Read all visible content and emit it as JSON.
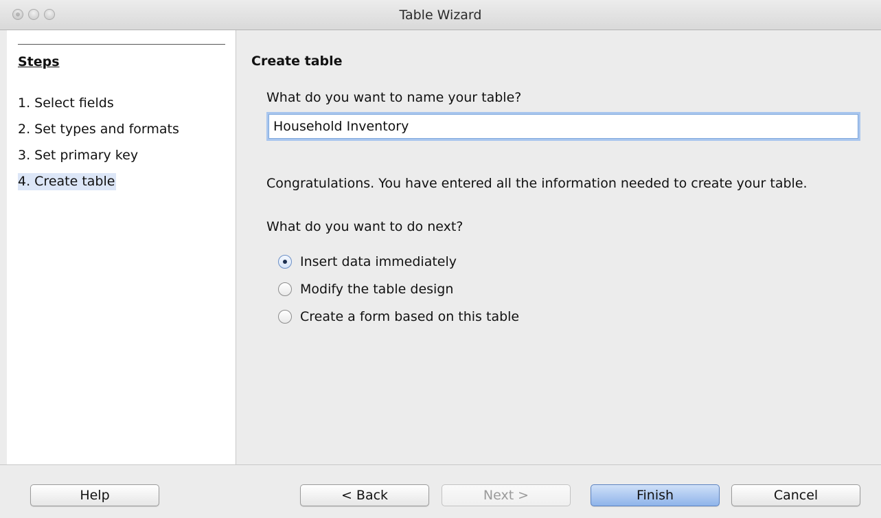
{
  "window": {
    "title": "Table Wizard"
  },
  "steps": {
    "heading": "Steps",
    "items": [
      {
        "label": "1. Select fields"
      },
      {
        "label": "2. Set types and formats"
      },
      {
        "label": "3. Set primary key"
      },
      {
        "label": "4. Create table",
        "active": true
      }
    ]
  },
  "main": {
    "heading": "Create table",
    "name_question": "What do you want to name your table?",
    "table_name_value": "Household Inventory",
    "congrats_text": "Congratulations. You have entered all the information needed to create your table.",
    "next_question": "What do you want to do next?",
    "options": [
      {
        "label": "Insert data immediately",
        "selected": true
      },
      {
        "label": "Modify the table design",
        "selected": false
      },
      {
        "label": "Create a form based on this table",
        "selected": false
      }
    ]
  },
  "buttons": {
    "help": "Help",
    "back": "< Back",
    "next": "Next >",
    "finish": "Finish",
    "cancel": "Cancel"
  },
  "colors": {
    "active_step_highlight": "#dce6f7",
    "focus_ring": "#a9c6ee",
    "primary_button": "#8fb4ea"
  }
}
